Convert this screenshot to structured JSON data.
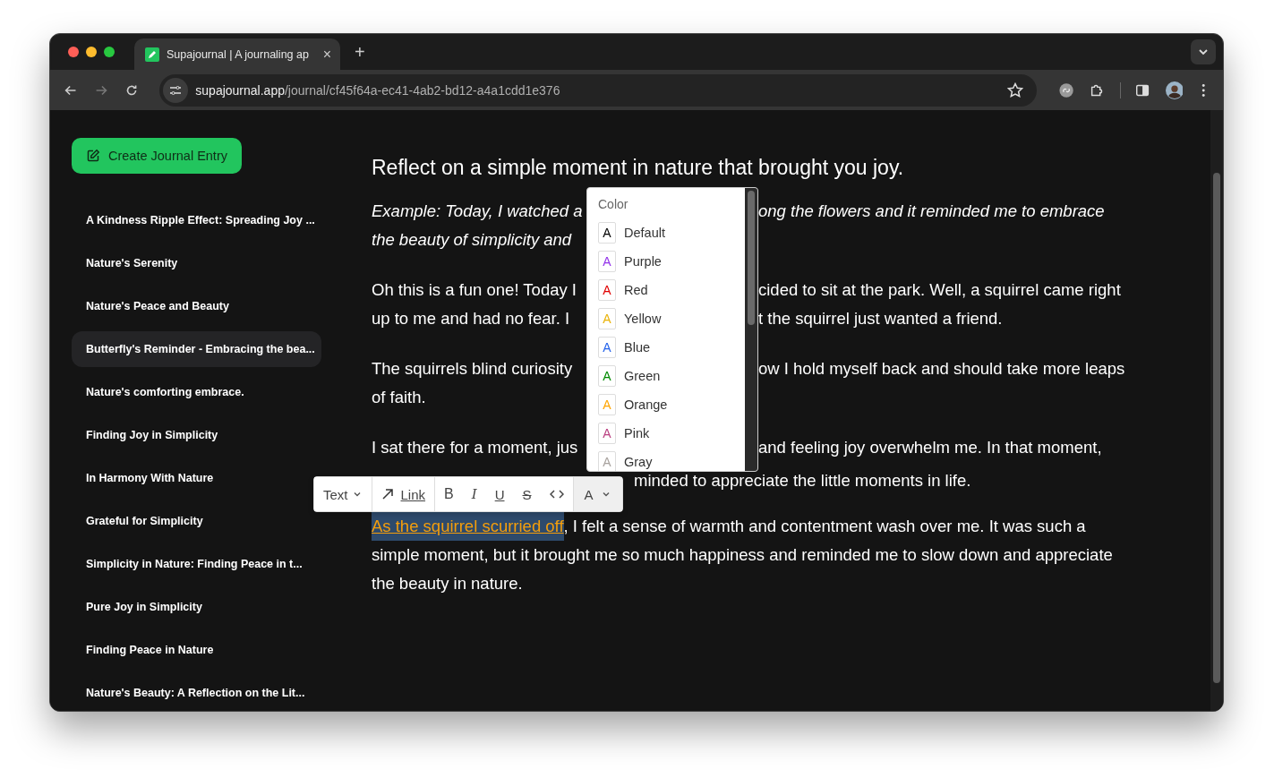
{
  "browser": {
    "tab": {
      "title": "Supajournal | A journaling ap",
      "close": "×"
    },
    "new_tab": "+",
    "url": {
      "domain": "supajournal.app",
      "path": "/journal/cf45f64a-ec41-4ab2-bd12-a4a1cdd1e376"
    },
    "forward_disabled": true
  },
  "sidebar": {
    "create_button": "Create Journal Entry",
    "items": [
      {
        "label": "A Kindness Ripple Effect: Spreading Joy ...",
        "selected": false
      },
      {
        "label": "Nature's Serenity",
        "selected": false
      },
      {
        "label": "Nature's Peace and Beauty",
        "selected": false
      },
      {
        "label": "Butterfly's Reminder - Embracing the bea...",
        "selected": true
      },
      {
        "label": "Nature's comforting embrace.",
        "selected": false
      },
      {
        "label": "Finding Joy in Simplicity",
        "selected": false
      },
      {
        "label": "In Harmony With Nature",
        "selected": false
      },
      {
        "label": "Grateful for Simplicity",
        "selected": false
      },
      {
        "label": "Simplicity in Nature: Finding Peace in t...",
        "selected": false
      },
      {
        "label": "Pure Joy in Simplicity",
        "selected": false
      },
      {
        "label": "Finding Peace in Nature",
        "selected": false
      },
      {
        "label": "Nature's Beauty: A Reflection on the Lit...",
        "selected": false
      }
    ]
  },
  "entry": {
    "prompt": "Reflect on a simple moment in nature that brought you joy.",
    "paragraphs": [
      {
        "kind": "example",
        "lines": [
          {
            "kind": "split",
            "left": "Example: Today, I watched a",
            "right": "ong the flowers and it reminded me to embrace"
          },
          {
            "kind": "split",
            "left": "the beauty of simplicity and"
          }
        ]
      },
      {
        "kind": "body",
        "lines": [
          {
            "kind": "split",
            "left": "Oh this is a fun one! Today I",
            "right": "cided to sit at the park. Well, a squirrel came right"
          },
          {
            "kind": "split",
            "left": "up to me and had no fear. I",
            "right": "t the squirrel just wanted a friend."
          }
        ]
      },
      {
        "kind": "body",
        "lines": [
          {
            "kind": "split",
            "left": "The squirrels blind curiosity",
            "right": "ow I hold myself back and should take more leaps"
          },
          {
            "kind": "full",
            "left": "of faith."
          }
        ]
      },
      {
        "kind": "body",
        "lines": [
          {
            "kind": "split",
            "left": "I sat there for a moment, jus",
            "right": "and feeling joy overwhelm me. In that moment,"
          },
          {
            "kind": "toolbar",
            "right": "minded to appreciate the little moments in life."
          }
        ]
      },
      {
        "kind": "body",
        "lines": [
          {
            "kind": "selection",
            "link": "As the squirrel scurried off",
            "left": ", I felt a sense of warmth and contentment wash over me. It was such a"
          },
          {
            "kind": "full",
            "left": "simple moment, but it brought me so much happiness and reminded me to slow down and appreciate"
          },
          {
            "kind": "full",
            "left": "the beauty in nature."
          }
        ]
      }
    ]
  },
  "format_toolbar": [
    {
      "kind": "dropdown",
      "label": "Text",
      "active": false
    },
    {
      "kind": "link",
      "label": "Link",
      "active": false
    },
    {
      "kind": "bold",
      "label": "B",
      "active": false
    },
    {
      "kind": "italic",
      "label": "I",
      "active": false
    },
    {
      "kind": "underline",
      "label": "U",
      "active": false
    },
    {
      "kind": "strike",
      "label": "S",
      "active": false
    },
    {
      "kind": "code",
      "active": false
    },
    {
      "kind": "color",
      "label": "A",
      "active": true
    }
  ],
  "color_menu": {
    "title": "Color",
    "items": [
      {
        "glyph": "A",
        "label": "Default",
        "color": "#000000"
      },
      {
        "glyph": "A",
        "label": "Purple",
        "color": "#9333ea"
      },
      {
        "glyph": "A",
        "label": "Red",
        "color": "#e00000"
      },
      {
        "glyph": "A",
        "label": "Yellow",
        "color": "#eab308"
      },
      {
        "glyph": "A",
        "label": "Blue",
        "color": "#2563eb"
      },
      {
        "glyph": "A",
        "label": "Green",
        "color": "#008a00"
      },
      {
        "glyph": "A",
        "label": "Orange",
        "color": "#ffa500"
      },
      {
        "glyph": "A",
        "label": "Pink",
        "color": "#ba4081"
      },
      {
        "glyph": "A",
        "label": "Gray",
        "color": "#a8a29e"
      }
    ]
  }
}
